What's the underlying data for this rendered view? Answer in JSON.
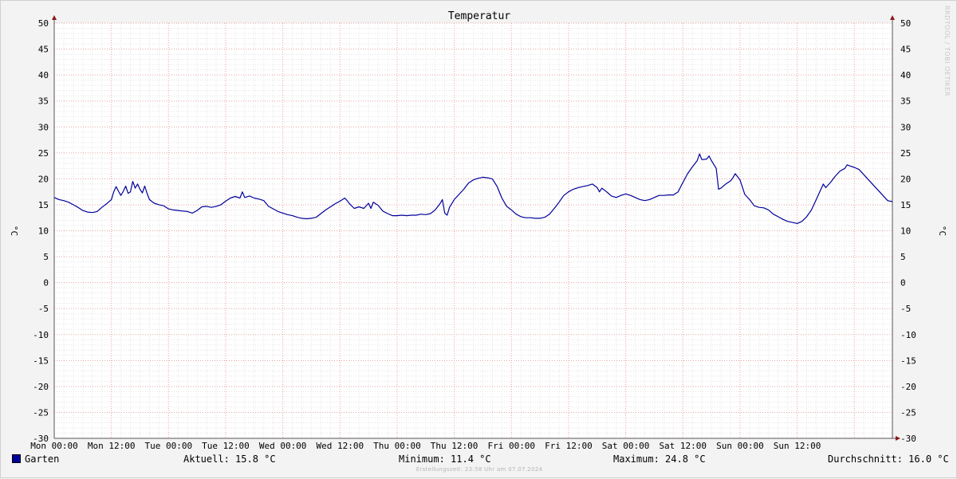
{
  "chart_data": {
    "type": "line",
    "title": "Temperatur",
    "ylabel": "°C",
    "ylabel_right": "°C",
    "ylim": [
      -30,
      50
    ],
    "yticks": [
      50,
      45,
      40,
      35,
      30,
      25,
      20,
      15,
      10,
      5,
      0,
      -5,
      -10,
      -15,
      -20,
      -25,
      -30
    ],
    "x_ticks": [
      "Mon 00:00",
      "Mon 12:00",
      "Tue 00:00",
      "Tue 12:00",
      "Wed 00:00",
      "Wed 12:00",
      "Thu 00:00",
      "Thu 12:00",
      "Fri 00:00",
      "Fri 12:00",
      "Sat 00:00",
      "Sat 12:00",
      "Sun 00:00",
      "Sun 12:00"
    ],
    "x_unit": "hours since Mon 00:00",
    "xlim": [
      0,
      168
    ],
    "grid": true,
    "series": [
      {
        "name": "Garten",
        "color": "#00009b",
        "points": [
          [
            0,
            16.4
          ],
          [
            1,
            16.0
          ],
          [
            2,
            15.8
          ],
          [
            3,
            15.5
          ],
          [
            4,
            15.0
          ],
          [
            5,
            14.5
          ],
          [
            6,
            13.9
          ],
          [
            7,
            13.6
          ],
          [
            8,
            13.5
          ],
          [
            9,
            13.7
          ],
          [
            10,
            14.5
          ],
          [
            11,
            15.2
          ],
          [
            12,
            16.0
          ],
          [
            12.5,
            17.5
          ],
          [
            13,
            18.5
          ],
          [
            13.5,
            17.6
          ],
          [
            14,
            16.8
          ],
          [
            14.5,
            17.6
          ],
          [
            15,
            18.6
          ],
          [
            15.5,
            17.2
          ],
          [
            16,
            17.5
          ],
          [
            16.5,
            19.5
          ],
          [
            17,
            18.2
          ],
          [
            17.5,
            19.0
          ],
          [
            18,
            18.0
          ],
          [
            18.5,
            17.3
          ],
          [
            19,
            18.6
          ],
          [
            19.5,
            17.2
          ],
          [
            20,
            16.0
          ],
          [
            21,
            15.3
          ],
          [
            22,
            15.0
          ],
          [
            23,
            14.8
          ],
          [
            24,
            14.2
          ],
          [
            25,
            14.0
          ],
          [
            26,
            13.9
          ],
          [
            27,
            13.8
          ],
          [
            28,
            13.7
          ],
          [
            29,
            13.4
          ],
          [
            30,
            13.9
          ],
          [
            31,
            14.6
          ],
          [
            32,
            14.7
          ],
          [
            33,
            14.5
          ],
          [
            34,
            14.7
          ],
          [
            35,
            15.0
          ],
          [
            36,
            15.7
          ],
          [
            37,
            16.3
          ],
          [
            38,
            16.6
          ],
          [
            39,
            16.3
          ],
          [
            39.5,
            17.5
          ],
          [
            40,
            16.4
          ],
          [
            41,
            16.7
          ],
          [
            42,
            16.3
          ],
          [
            43,
            16.1
          ],
          [
            44,
            15.8
          ],
          [
            45,
            14.7
          ],
          [
            46,
            14.2
          ],
          [
            47,
            13.7
          ],
          [
            48,
            13.4
          ],
          [
            49,
            13.1
          ],
          [
            50,
            12.9
          ],
          [
            51,
            12.6
          ],
          [
            52,
            12.4
          ],
          [
            53,
            12.3
          ],
          [
            54,
            12.4
          ],
          [
            55,
            12.6
          ],
          [
            56,
            13.3
          ],
          [
            57,
            14.0
          ],
          [
            58,
            14.6
          ],
          [
            59,
            15.2
          ],
          [
            60,
            15.7
          ],
          [
            61,
            16.3
          ],
          [
            61.5,
            15.8
          ],
          [
            62,
            15.2
          ],
          [
            63,
            14.3
          ],
          [
            64,
            14.6
          ],
          [
            65,
            14.3
          ],
          [
            66,
            15.3
          ],
          [
            66.5,
            14.3
          ],
          [
            67,
            15.5
          ],
          [
            68,
            14.9
          ],
          [
            69,
            13.8
          ],
          [
            70,
            13.3
          ],
          [
            71,
            12.9
          ],
          [
            72,
            12.9
          ],
          [
            73,
            13.0
          ],
          [
            74,
            12.9
          ],
          [
            75,
            13.0
          ],
          [
            76,
            13.0
          ],
          [
            77,
            13.2
          ],
          [
            78,
            13.1
          ],
          [
            79,
            13.3
          ],
          [
            80,
            14.0
          ],
          [
            81,
            15.2
          ],
          [
            81.5,
            16.0
          ],
          [
            82,
            13.4
          ],
          [
            82.5,
            13.0
          ],
          [
            83,
            14.5
          ],
          [
            84,
            16.0
          ],
          [
            85,
            17.0
          ],
          [
            86,
            18.0
          ],
          [
            87,
            19.2
          ],
          [
            88,
            19.8
          ],
          [
            89,
            20.1
          ],
          [
            90,
            20.3
          ],
          [
            91,
            20.2
          ],
          [
            92,
            20.0
          ],
          [
            93,
            18.5
          ],
          [
            94,
            16.3
          ],
          [
            95,
            14.7
          ],
          [
            96,
            14.0
          ],
          [
            97,
            13.2
          ],
          [
            98,
            12.7
          ],
          [
            99,
            12.5
          ],
          [
            100,
            12.5
          ],
          [
            101,
            12.4
          ],
          [
            102,
            12.4
          ],
          [
            103,
            12.6
          ],
          [
            104,
            13.2
          ],
          [
            105,
            14.3
          ],
          [
            106,
            15.5
          ],
          [
            107,
            16.8
          ],
          [
            108,
            17.5
          ],
          [
            109,
            18.0
          ],
          [
            110,
            18.3
          ],
          [
            111,
            18.5
          ],
          [
            112,
            18.7
          ],
          [
            113,
            19.0
          ],
          [
            114,
            18.3
          ],
          [
            114.5,
            17.5
          ],
          [
            115,
            18.2
          ],
          [
            116,
            17.5
          ],
          [
            117,
            16.7
          ],
          [
            118,
            16.4
          ],
          [
            119,
            16.8
          ],
          [
            120,
            17.1
          ],
          [
            121,
            16.8
          ],
          [
            122,
            16.4
          ],
          [
            123,
            16.0
          ],
          [
            124,
            15.8
          ],
          [
            125,
            16.0
          ],
          [
            126,
            16.4
          ],
          [
            127,
            16.8
          ],
          [
            128,
            16.8
          ],
          [
            129,
            16.9
          ],
          [
            130,
            16.9
          ],
          [
            131,
            17.5
          ],
          [
            132,
            19.3
          ],
          [
            133,
            21.0
          ],
          [
            134,
            22.3
          ],
          [
            135,
            23.5
          ],
          [
            135.5,
            24.8
          ],
          [
            136,
            23.7
          ],
          [
            137,
            23.8
          ],
          [
            137.5,
            24.4
          ],
          [
            138,
            23.5
          ],
          [
            139,
            22.0
          ],
          [
            139.5,
            18.0
          ],
          [
            140,
            18.2
          ],
          [
            141,
            19.0
          ],
          [
            142,
            19.6
          ],
          [
            142.5,
            20.2
          ],
          [
            143,
            21.0
          ],
          [
            144,
            19.8
          ],
          [
            145,
            17.0
          ],
          [
            146,
            16.0
          ],
          [
            147,
            14.8
          ],
          [
            148,
            14.5
          ],
          [
            149,
            14.4
          ],
          [
            150,
            14.0
          ],
          [
            151,
            13.2
          ],
          [
            152,
            12.7
          ],
          [
            153,
            12.2
          ],
          [
            154,
            11.8
          ],
          [
            155,
            11.6
          ],
          [
            156,
            11.4
          ],
          [
            157,
            11.8
          ],
          [
            158,
            12.7
          ],
          [
            159,
            14.0
          ],
          [
            160,
            16.0
          ],
          [
            161,
            18.0
          ],
          [
            161.5,
            19.0
          ],
          [
            162,
            18.3
          ],
          [
            163,
            19.3
          ],
          [
            164,
            20.5
          ],
          [
            165,
            21.5
          ],
          [
            166,
            22.0
          ],
          [
            166.5,
            22.7
          ],
          [
            167,
            22.5
          ],
          [
            168,
            22.2
          ],
          [
            169,
            21.8
          ],
          [
            170,
            20.8
          ],
          [
            171,
            19.8
          ],
          [
            172,
            18.8
          ],
          [
            173,
            17.8
          ],
          [
            174,
            16.8
          ],
          [
            175,
            15.8
          ],
          [
            176,
            15.6
          ]
        ]
      }
    ]
  },
  "legend": {
    "series_name": "Garten",
    "aktuell": "Aktuell: 15.8 °C",
    "minimum": "Minimum: 11.4 °C",
    "maximum": "Maximum: 24.8 °C",
    "durchschnitt": "Durchschnitt: 16.0 °C",
    "swatch_color": "#00009b"
  },
  "footer": "Erstellungszeit: 23:58 Uhr am 07.07.2024",
  "watermark": "RRDTOOL / TOBI OETIKER"
}
